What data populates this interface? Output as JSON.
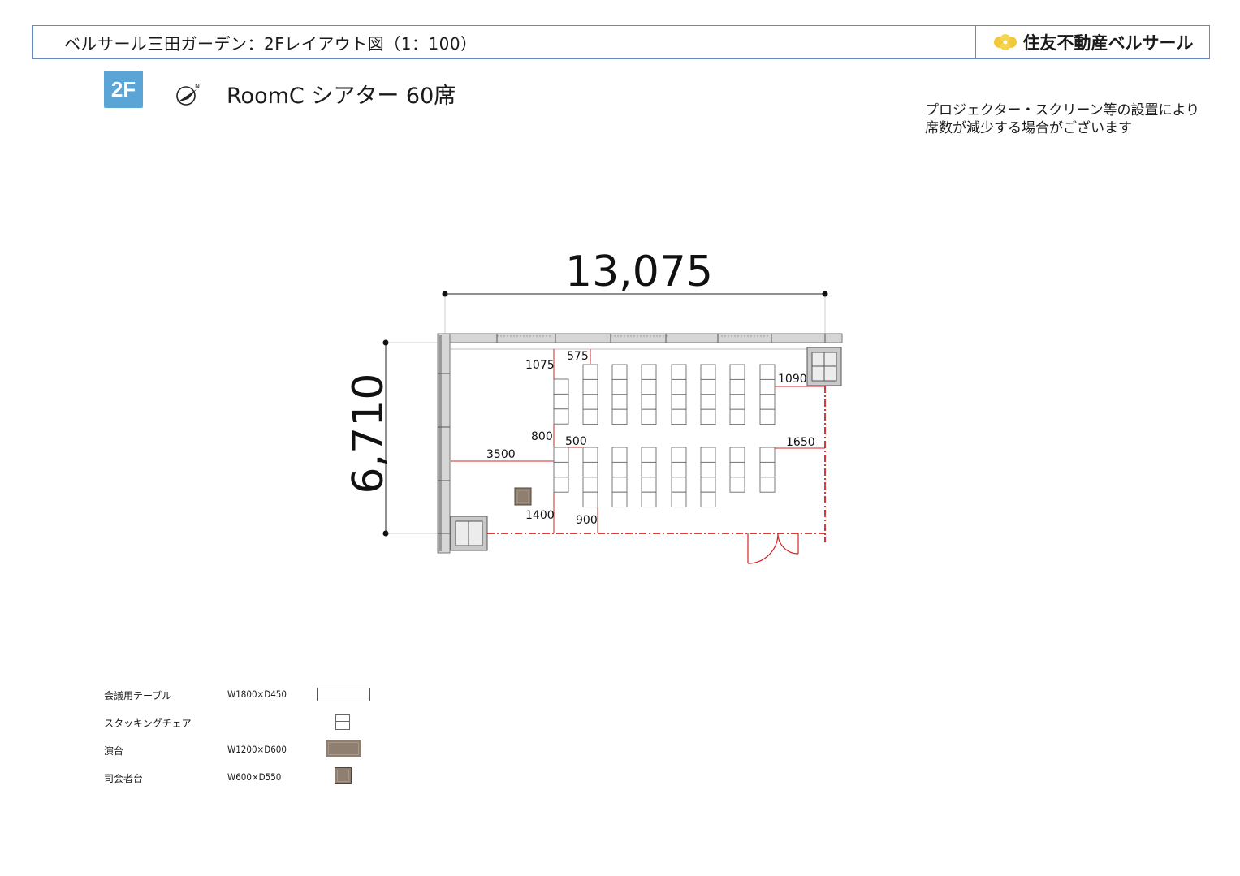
{
  "header": {
    "title": "ベルサール三田ガーデン：2Fレイアウト図（1：100）",
    "brand": "住友不動産ベルサール",
    "border_color": "#6a86bf"
  },
  "floor_badge": {
    "label": "2F",
    "color": "#5aa4d6"
  },
  "compass": {
    "icon": "north-arrow-icon",
    "label": "N"
  },
  "room_title": "RoomC シアター 60席",
  "note": {
    "line1": "プロジェクター・スクリーン等の設置により",
    "line2": "席数が減少する場合がございます"
  },
  "floor_plan": {
    "overall_width_label": "13,075",
    "overall_height_label": "6,710",
    "dimension_labels": [
      "1075",
      "575",
      "1090",
      "800",
      "500",
      "1650",
      "3500",
      "1400",
      "900"
    ],
    "wall_color": "#b9b9b9",
    "dim_line_color": "#d92020",
    "stage_color": "#8f7f70"
  },
  "legend": [
    {
      "label": "会議用テーブル",
      "size": "W1800×D450",
      "swatch": "table"
    },
    {
      "label": "スタッキングチェア",
      "size": "",
      "swatch": "chair"
    },
    {
      "label": "演台",
      "size": "W1200×D600",
      "swatch": "podium"
    },
    {
      "label": "司会者台",
      "size": "W600×D550",
      "swatch": "mc-stand"
    }
  ]
}
